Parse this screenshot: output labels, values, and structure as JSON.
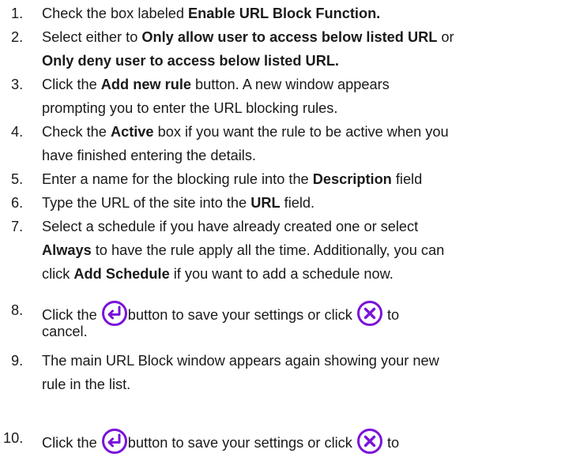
{
  "accent_color": "#7b12d9",
  "steps": [
    {
      "number": "1.",
      "lines": [
        [
          {
            "t": "Check the box labeled "
          },
          {
            "b": "Enable URL Block Function."
          }
        ]
      ]
    },
    {
      "number": "2.",
      "lines": [
        [
          {
            "t": "Select either to "
          },
          {
            "b": "Only allow user to access below listed URL"
          },
          {
            "t": " or"
          }
        ],
        [
          {
            "b": "Only deny user to access below listed URL."
          }
        ]
      ]
    },
    {
      "number": "3.",
      "lines": [
        [
          {
            "t": "Click the "
          },
          {
            "b": "Add new rule"
          },
          {
            "t": " button. A new window appears"
          }
        ],
        [
          {
            "t": "prompting you to enter the URL blocking rules."
          }
        ]
      ]
    },
    {
      "number": "4.",
      "lines": [
        [
          {
            "t": "Check the "
          },
          {
            "b": "Active"
          },
          {
            "t": " box if you want the rule to be active when you"
          }
        ],
        [
          {
            "t": "have finished entering the details."
          }
        ]
      ]
    },
    {
      "number": "5.",
      "lines": [
        [
          {
            "t": "Enter a name for the blocking rule into the "
          },
          {
            "b": "Description"
          },
          {
            "t": " field"
          }
        ]
      ]
    },
    {
      "number": "6.",
      "lines": [
        [
          {
            "t": "Type the URL of the site into the "
          },
          {
            "b": "URL"
          },
          {
            "t": " field."
          }
        ]
      ]
    },
    {
      "number": "7.",
      "lines": [
        [
          {
            "t": "Select a schedule if you have already created one or select"
          }
        ],
        [
          {
            "b": "Always"
          },
          {
            "t": " to have the rule apply all the time. Additionally, you can"
          }
        ],
        [
          {
            "t": "click "
          },
          {
            "b": "Add Schedule"
          },
          {
            "t": " if you want to add a schedule now."
          }
        ]
      ]
    },
    {
      "number": "8.",
      "lines": [
        [
          {
            "t": "Click the "
          },
          {
            "icon": "save-return-icon"
          },
          {
            "t": "button to save your settings or click "
          },
          {
            "icon": "cancel-x-icon"
          },
          {
            "t": " to"
          }
        ],
        [
          {
            "t": "cancel."
          }
        ]
      ]
    },
    {
      "number": "9.",
      "lines": [
        [
          {
            "t": "The main URL Block window appears again showing your new"
          }
        ],
        [
          {
            "t": "rule in the list."
          }
        ]
      ]
    },
    {
      "number": "10.",
      "lines": [
        [
          {
            "t": "Click the "
          },
          {
            "icon": "save-return-icon"
          },
          {
            "t": "button to save your settings or click "
          },
          {
            "icon": "cancel-x-icon"
          },
          {
            "t": " to"
          }
        ]
      ]
    }
  ]
}
